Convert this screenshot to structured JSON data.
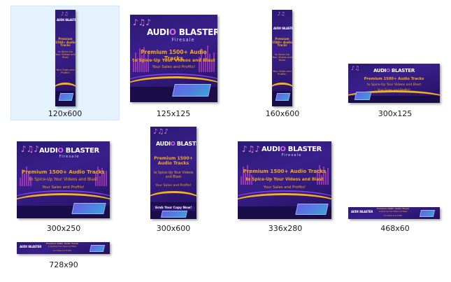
{
  "explorer": {
    "selected_index": 0,
    "items": [
      {
        "name": "120x600"
      },
      {
        "name": "125x125"
      },
      {
        "name": "160x600"
      },
      {
        "name": "300x125"
      },
      {
        "name": "300x250"
      },
      {
        "name": "300x600"
      },
      {
        "name": "336x280"
      },
      {
        "name": "468x60"
      },
      {
        "name": "728x90"
      }
    ]
  },
  "banner": {
    "brand_left": "AUDI",
    "brand_o": "O",
    "brand_right": "BLASTER",
    "brand_tag": "Firesale",
    "headline_1": "Premium 1500+ Audio Tracks",
    "headline_2": "to Spice-Up Your Videos and Blast",
    "headline_3": "Your Sales and Profits!",
    "cta": "Grab Your Copy Now!"
  },
  "colors": {
    "banner_bg": "#2a1a72",
    "accent_gold": "#f4a91c",
    "accent_pink": "#d06be0",
    "selection_bg": "#e5f3ff"
  }
}
